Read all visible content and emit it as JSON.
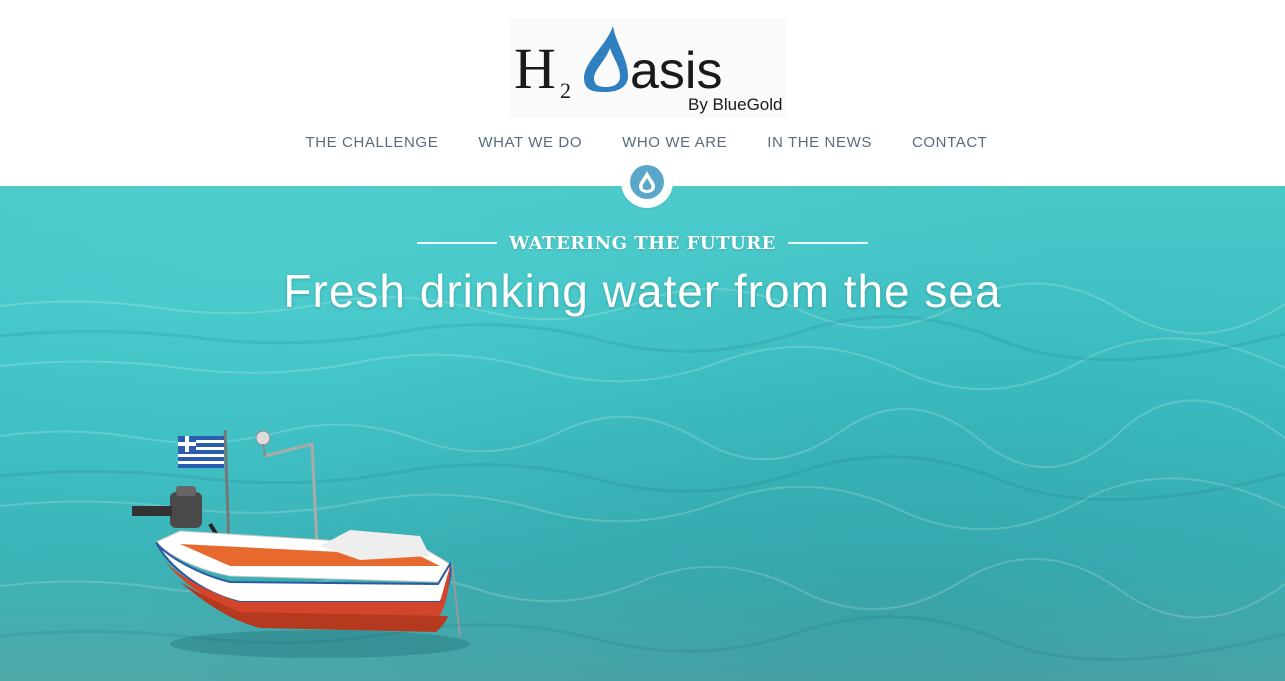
{
  "header": {
    "logo": {
      "h": "H",
      "sub": "2",
      "asis": "asis",
      "tagline": "By BlueGold"
    },
    "nav": [
      {
        "label": "THE CHALLENGE"
      },
      {
        "label": "WHAT WE DO"
      },
      {
        "label": "WHO WE ARE"
      },
      {
        "label": "IN THE NEWS"
      },
      {
        "label": "CONTACT"
      }
    ],
    "badge_icon": "water-drop-icon"
  },
  "hero": {
    "kicker": "WATERING THE FUTURE",
    "headline": "Fresh drinking water from the sea",
    "image": "boat-on-turquoise-sea"
  },
  "colors": {
    "nav_text": "#5b6b7d",
    "drop_blue": "#5ba7c9",
    "logo_drop": "#2f7fc1",
    "sea": "#3fbfc3"
  }
}
